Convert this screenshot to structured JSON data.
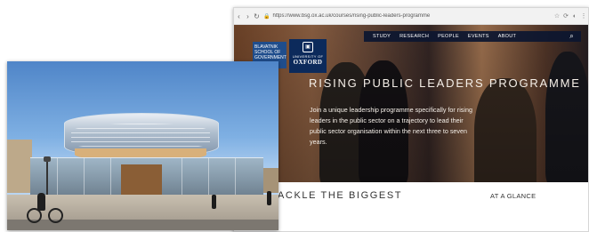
{
  "browser": {
    "url": "https://www.bsg.ox.ac.uk/courses/rising-public-leaders-programme"
  },
  "nav": {
    "items": [
      "STUDY",
      "RESEARCH",
      "PEOPLE",
      "EVENTS",
      "ABOUT"
    ],
    "search_icon": "search-icon"
  },
  "logos": {
    "bsg_lines": [
      "BLAVATNIK",
      "SCHOOL OF",
      "GOVERNMENT"
    ],
    "oxford_university": "UNIVERSITY OF",
    "oxford_name": "OXFORD"
  },
  "hero": {
    "title": "RISING PUBLIC LEADERS PROGRAMME",
    "description": "Join a unique leadership programme specifically for rising leaders in the public sector on a trajectory to lead their public sector organisation within the next three to seven years."
  },
  "content": {
    "heading": "ACKLE THE BIGGEST",
    "glance": "AT A GLANCE"
  },
  "colors": {
    "nav_bg": "#0c162f",
    "oxford_blue": "#0c2a5b",
    "bsg_blue": "#1f4d8c"
  }
}
